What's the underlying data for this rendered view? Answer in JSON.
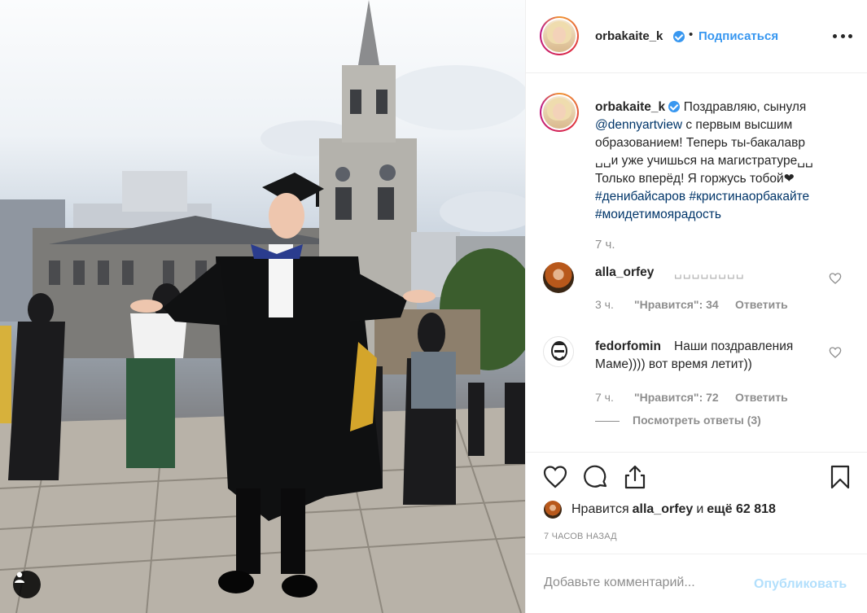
{
  "post": {
    "author": "orbakaite_k",
    "follow_label": "Подписаться",
    "separator": "•",
    "caption": {
      "lines": [
        {
          "text": "Поздравляю, сынуля"
        },
        {
          "link": "@dennyartview",
          "text": " с первым высшим"
        },
        {
          "text": "образованием! Теперь ты-бакалавр"
        },
        {
          "text": "␣␣и уже учишься на магистратуре␣␣"
        },
        {
          "text": "Только вперёд! Я горжусь тобой❤"
        },
        {
          "link": "#денибайсаров #кристинаорбакайте"
        },
        {
          "link": "#моидетимоярадость"
        }
      ],
      "time": "7 ч."
    },
    "comments": [
      {
        "user": "alla_orfey",
        "text": "␣␣␣␣␣␣␣␣",
        "time": "3 ч.",
        "likes": "\"Нравится\": 34",
        "reply": "Ответить"
      },
      {
        "user": "fedorfomin",
        "text_line1": "Наши поздравления",
        "text_line2": "Маме)))) вот время летит))",
        "time": "7 ч.",
        "likes": "\"Нравится\": 72",
        "reply": "Ответить",
        "view_replies": "Посмотреть ответы (3)"
      }
    ],
    "liked_by": {
      "prefix": "Нравится ",
      "user": "alla_orfey",
      "middle": " и ",
      "count": "ещё 62 818"
    },
    "timestamp": "7 ЧАСОВ НАЗАД",
    "comment_placeholder": "Добавьте комментарий...",
    "publish_label": "Опубликовать"
  },
  "colors": {
    "accent": "#3897f0",
    "text": "#262626",
    "muted": "#8e8e8e",
    "link": "#003569",
    "publish_disabled": "#b2dffc"
  }
}
